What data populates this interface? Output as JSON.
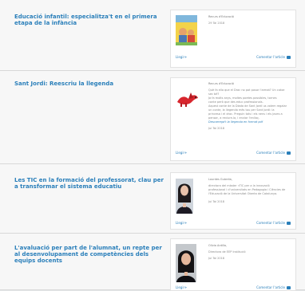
{
  "posts": [
    {
      "title": "Educació infantil: especialitza't en el primera etapa de la infància",
      "author": "Recurs d'Educació",
      "date": "29 Tai 2018",
      "excerpt": [],
      "link_text": "",
      "left_link": "Llegir+",
      "comment_link": "Comentar l'article"
    },
    {
      "title": "Sant Jordi: Reescriu la llegenda",
      "author": "Recurs d'Educació",
      "date": "Jul Tai 2018",
      "excerpt": [
        "Què fa ella que el Drac no pot posar l'armat? Un cotxe",
        "sec bé?",
        "Ja fa molts anys, moltes poetes possibles, tornes",
        "conte però que des educ professionals.",
        "Aquest conte de la Diada de Sant Jordi us volem regalar",
        "un conte, la llegenda més tou per Sant Jordi: la",
        "princesa i el drac. Preguin tots i els nens i els joves a",
        "pensar, a reviure-la, i enviar l'enllaç."
      ],
      "link_text": "Descarrega't la llegenda en format pdf",
      "left_link": "Llegir+",
      "comment_link": "Comentar l'article"
    },
    {
      "title": "Les TIC en la formació del professorat, clau per a transformar el sistema educatiu",
      "author": "Lourdes Guàrdia,",
      "date": "Jul Tai 2018",
      "excerpt": [
        "directora del màster «TIC per a la innovació",
        "professional i d'universitats en Pedagogia i Ciències de",
        "l'Educació de la Universitat Oberta de Catalunya."
      ],
      "link_text": "",
      "left_link": "Llegir+",
      "comment_link": "Comentar l'article"
    },
    {
      "title": "L'avaluació per part de l'alumnat, un repte per al desenvolupament de competències dels equips docents",
      "author": "Olívia Ardilla,",
      "date": "Jul Tai 2018",
      "excerpt": [
        "Directora de EEP Institució"
      ],
      "link_text": "",
      "left_link": "Llegir+",
      "comment_link": "Comentar l'article"
    }
  ]
}
